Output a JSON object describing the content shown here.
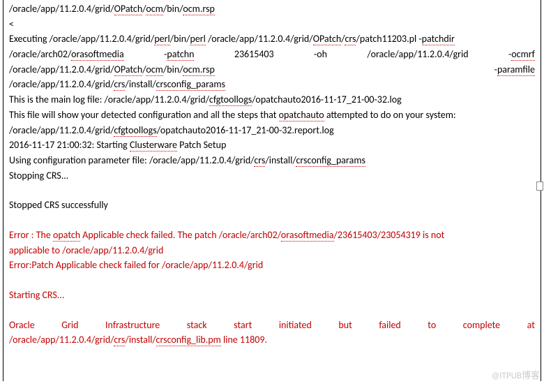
{
  "lines": {
    "l1": "/oracle/app/11.2.0.4/grid/",
    "l1b": "OPatch",
    "l1c": "/",
    "l1d": "ocm",
    "l1e": "/bin/",
    "l1f": "ocm.rsp",
    "l2": "<",
    "l3a": "Executing   /oracle/app/11.2.0.4/grid/",
    "l3b": "perl",
    "l3c": "/bin/",
    "l3d": "perl",
    "l3e": "   /oracle/app/11.2.0.4/grid/",
    "l3f": "OPatch",
    "l3g": "/",
    "l3h": "crs",
    "l3i": "/patch11203.pl   -",
    "l3j": "patchdir",
    "l4a": "/oracle/arch02/",
    "l4b": "orasoftmedia",
    "l4c": "-",
    "l4d": "patchn",
    "l4e": "23615403",
    "l4f": "-oh",
    "l4g": "/oracle/app/11.2.0.4/grid",
    "l4h": "-",
    "l4i": "ocmrf",
    "l5a": "/oracle/app/11.2.0.4/grid/",
    "l5b": "OPatch",
    "l5c": "/",
    "l5d": "ocm",
    "l5e": "/bin/",
    "l5f": "ocm.rsp",
    "l5g": "-",
    "l5h": "paramfile",
    "l6a": "/oracle/app/11.2.0.4/grid/",
    "l6b": "crs",
    "l6c": "/install/",
    "l6d": "crsconfig_params",
    "l7a": "This is the main log file: /oracle/app/11.2.0.4/grid/",
    "l7b": "cfgtoollogs",
    "l7c": "/opatchauto2016-11-17_21-00-32.log",
    "l8a": "This file will show your detected configuration and all the steps that ",
    "l8b": "opatchauto",
    "l8c": " attempted to do on your system:",
    "l9a": "/oracle/app/11.2.0.4/grid/",
    "l9b": "cfgtoollogs",
    "l9c": "/opatchauto2016-11-17_21-00-32.report.log",
    "l10a": "2016-11-17 21:00:32: Starting ",
    "l10b": "Clusterware",
    "l10c": " Patch Setup",
    "l11a": "Using configuration parameter file: /oracle/app/11.2.0.4/grid/",
    "l11b": "crs",
    "l11c": "/install/",
    "l11d": "crsconfig_params",
    "l12": "Stopping CRS...",
    "l13": "Stopped CRS successfully",
    "l14a": "Error : The ",
    "l14b": "opatch",
    "l14c": " Applicable  check  failed.     The  patch /oracle/arch02/",
    "l14d": "orasoftmedia",
    "l14e": "/23615403/23054319  is  not",
    "l15": "applicable to /oracle/app/11.2.0.4/grid",
    "l16": "Error:Patch Applicable check failed for /oracle/app/11.2.0.4/grid",
    "l17": "Starting CRS...",
    "l18_w1": "Oracle",
    "l18_w2": "Grid",
    "l18_w3": "Infrastructure",
    "l18_w4": "stack",
    "l18_w5": "start",
    "l18_w6": "initiated",
    "l18_w7": "but",
    "l18_w8": "failed",
    "l18_w9": "to",
    "l18_w10": "complete",
    "l18_w11": "at",
    "l19a": "/oracle/app/11.2.0.4/grid/",
    "l19b": "crs",
    "l19c": "/install/",
    "l19d": "crsconfig_lib.pm",
    "l19e": " line 11809."
  },
  "watermark": "@ITPUB博客"
}
